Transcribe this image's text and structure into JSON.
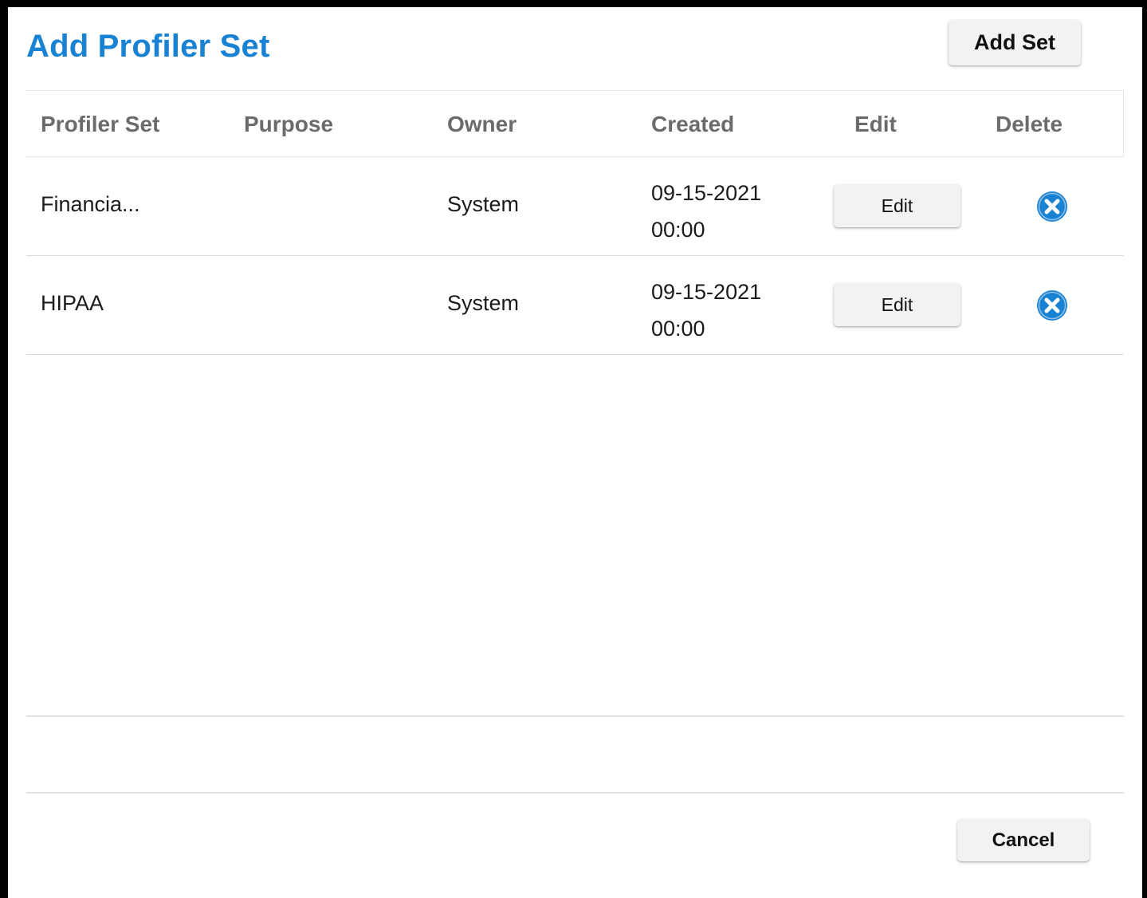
{
  "dialog": {
    "title": "Add Profiler Set",
    "add_set_label": "Add Set",
    "cancel_label": "Cancel"
  },
  "table": {
    "headers": {
      "profiler_set": "Profiler Set",
      "purpose": "Purpose",
      "owner": "Owner",
      "created": "Created",
      "edit": "Edit",
      "delete": "Delete"
    },
    "rows": [
      {
        "profiler_set": "Financia...",
        "purpose": "",
        "owner": "System",
        "created_date": "09-15-2021",
        "created_time": "00:00",
        "edit_label": "Edit",
        "delete_icon": "circle-x-icon"
      },
      {
        "profiler_set": "HIPAA",
        "purpose": "",
        "owner": "System",
        "created_date": "09-15-2021",
        "created_time": "00:00",
        "edit_label": "Edit",
        "delete_icon": "circle-x-icon"
      }
    ]
  },
  "colors": {
    "title": "#1a82d3",
    "delete_icon": "#1a82d3",
    "header_text": "#6b6b6b",
    "button_bg": "#f2f2f2"
  }
}
